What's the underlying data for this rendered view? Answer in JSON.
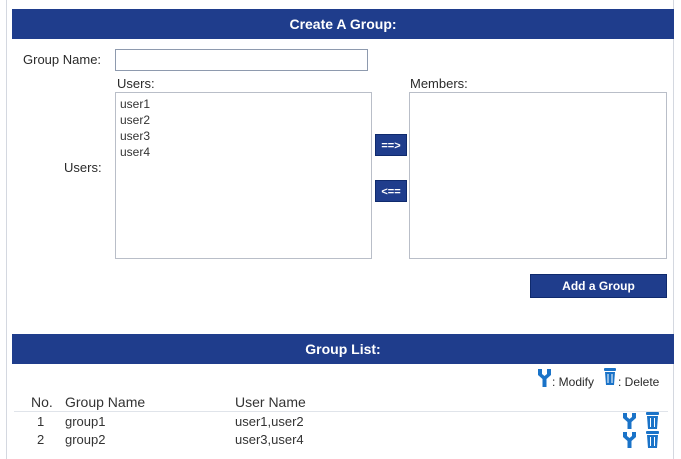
{
  "create": {
    "title": "Create A Group:",
    "group_name_label": "Group Name:",
    "group_name_value": "",
    "users_label_top": "Users:",
    "users_label_left": "Users:",
    "members_label": "Members:",
    "users": [
      "user1",
      "user2",
      "user3",
      "user4"
    ],
    "members": [],
    "add_arrow": "==>",
    "remove_arrow": "<==",
    "add_button": "Add a Group"
  },
  "group_list": {
    "title": "Group List:",
    "legend_modify": ": Modify",
    "legend_delete": ": Delete",
    "columns": {
      "no": "No.",
      "group_name": "Group Name",
      "user_name": "User Name"
    },
    "rows": [
      {
        "no": "1",
        "group_name": "group1",
        "user_name": "user1,user2"
      },
      {
        "no": "2",
        "group_name": "group2",
        "user_name": "user3,user4"
      }
    ]
  },
  "icons": {
    "modify": "wrench-icon",
    "delete": "trash-icon"
  },
  "colors": {
    "bar": "#1f3d8c",
    "icon": "#1a73c8"
  }
}
